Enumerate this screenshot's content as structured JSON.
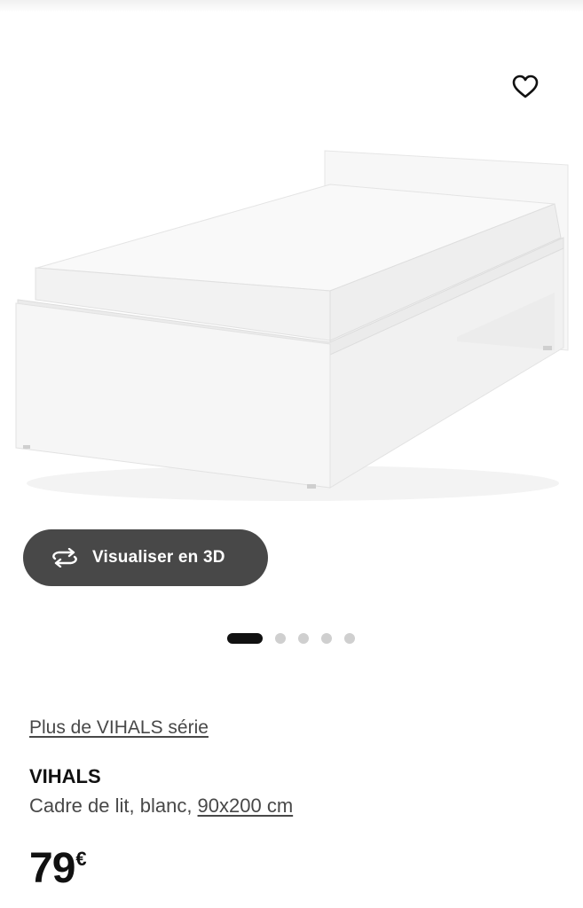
{
  "product": {
    "image_alt": "Cadre de lit VIHALS blanc",
    "favorite_icon": "heart-outline-icon",
    "view_3d": {
      "icon": "rotate-3d-icon",
      "label": "Visualiser en 3D"
    },
    "carousel": {
      "total": 5,
      "active": 1
    },
    "series_link": "Plus de VIHALS série",
    "name": "VIHALS",
    "description": "Cadre de lit, blanc, ",
    "size_link": "90x200 cm",
    "price": {
      "amount": "79",
      "currency": "€"
    }
  },
  "colors": {
    "button_bg": "#484848",
    "text_primary": "#111111",
    "text_secondary": "#484848",
    "dot_active": "#111111",
    "dot_inactive": "#cfcfcf"
  }
}
